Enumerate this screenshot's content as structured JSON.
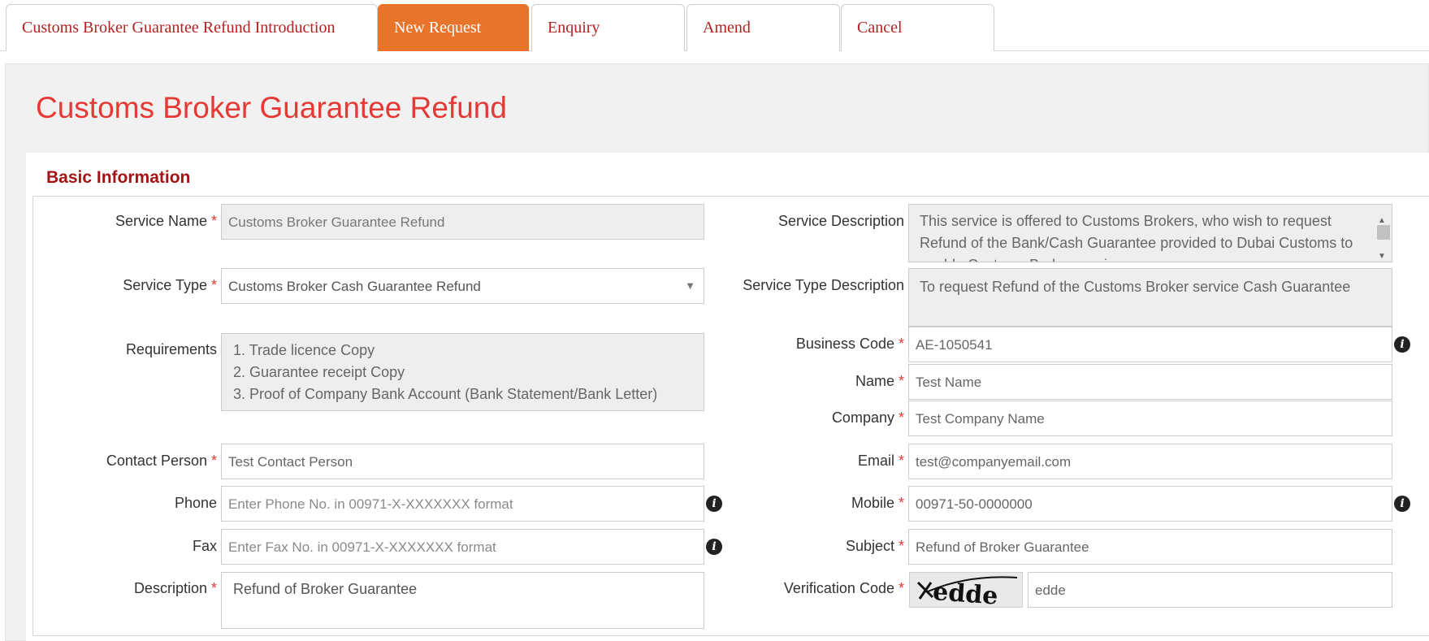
{
  "tabs": [
    {
      "label": "Customs Broker Guarantee Refund Introduction",
      "active": false
    },
    {
      "label": "New Request",
      "active": true
    },
    {
      "label": "Enquiry",
      "active": false
    },
    {
      "label": "Amend",
      "active": false
    },
    {
      "label": "Cancel",
      "active": false
    }
  ],
  "page": {
    "title": "Customs Broker Guarantee Refund"
  },
  "section": {
    "title": "Basic Information"
  },
  "required_marker": "*",
  "form": {
    "service_name": {
      "label": "Service Name",
      "value": "Customs Broker Guarantee Refund"
    },
    "service_type": {
      "label": "Service Type",
      "value": "Customs Broker Cash Guarantee Refund",
      "arrow": "▼"
    },
    "requirements": {
      "label": "Requirements",
      "items": [
        "1. Trade licence Copy",
        "2. Guarantee receipt Copy",
        "3. Proof of Company Bank Account (Bank Statement/Bank Letter)"
      ]
    },
    "contact_person": {
      "label": "Contact Person",
      "value": "Test Contact Person"
    },
    "phone": {
      "label": "Phone",
      "placeholder": "Enter Phone No. in 00971-X-XXXXXXX format"
    },
    "fax": {
      "label": "Fax",
      "placeholder": "Enter Fax No. in 00971-X-XXXXXXX format"
    },
    "description": {
      "label": "Description",
      "value": "Refund of Broker Guarantee"
    },
    "service_description": {
      "label": "Service Description",
      "value": "This service is offered to Customs Brokers, who wish to request Refund of the Bank/Cash Guarantee provided to Dubai Customs to enable Customs Broker services."
    },
    "service_type_description": {
      "label": "Service Type Description",
      "value": "To request Refund of the Customs Broker service Cash Guarantee"
    },
    "business_code": {
      "label": "Business Code",
      "value": "AE-1050541"
    },
    "name": {
      "label": "Name",
      "value": "Test Name"
    },
    "company": {
      "label": "Company",
      "value": "Test Company Name"
    },
    "email": {
      "label": "Email",
      "value": "test@companyemail.com"
    },
    "mobile": {
      "label": "Mobile",
      "value": "00971-50-0000000"
    },
    "subject": {
      "label": "Subject",
      "value": "Refund of Broker Guarantee"
    },
    "verification_code": {
      "label": "Verification Code",
      "captcha_text": "edde",
      "value": "edde"
    }
  },
  "icons": {
    "info": "info-circle-icon",
    "info_glyph": "i",
    "scroll_up_glyph": "▲",
    "scroll_down_glyph": "▼"
  },
  "colors": {
    "accent": "#e8732a",
    "title": "#e53935",
    "section": "#a31515",
    "tab_text": "#b22222"
  }
}
